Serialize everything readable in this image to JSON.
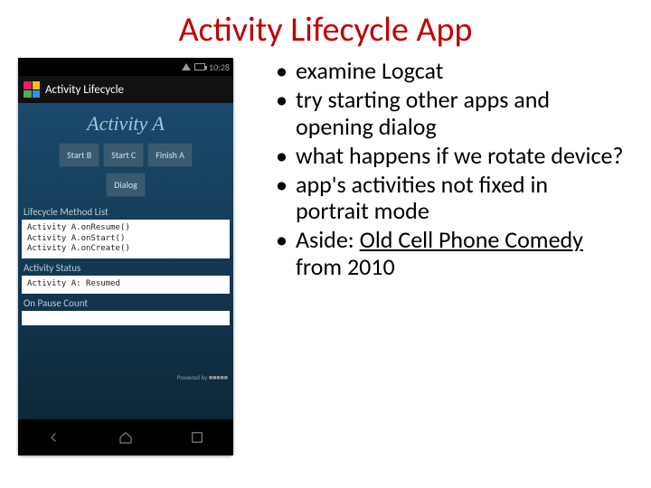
{
  "title": "Activity Lifecycle App",
  "phone": {
    "time": "10:28",
    "appbar_title": "Activity Lifecycle",
    "activity_title": "Activity A",
    "buttons": {
      "start_b": "Start B",
      "start_c": "Start C",
      "finish_a": "Finish A",
      "dialog": "Dialog"
    },
    "sections": {
      "method_list_label": "Lifecycle Method List",
      "method_list": [
        "Activity A.onResume()",
        "Activity A.onStart()",
        "Activity A.onCreate()"
      ],
      "status_label": "Activity Status",
      "status_value": "Activity A: Resumed",
      "pause_label": "On Pause Count"
    },
    "powered": "Powered by ■■■■■"
  },
  "bullets": {
    "b1": "examine Logcat",
    "b2": "try starting other apps and opening dialog",
    "b3": "what happens if we rotate device?",
    "b4": "app's activities not fixed in portrait mode",
    "b5_pre": "Aside: ",
    "b5_link": "Old Cell Phone Comedy",
    "b5_post": " from 2010"
  }
}
